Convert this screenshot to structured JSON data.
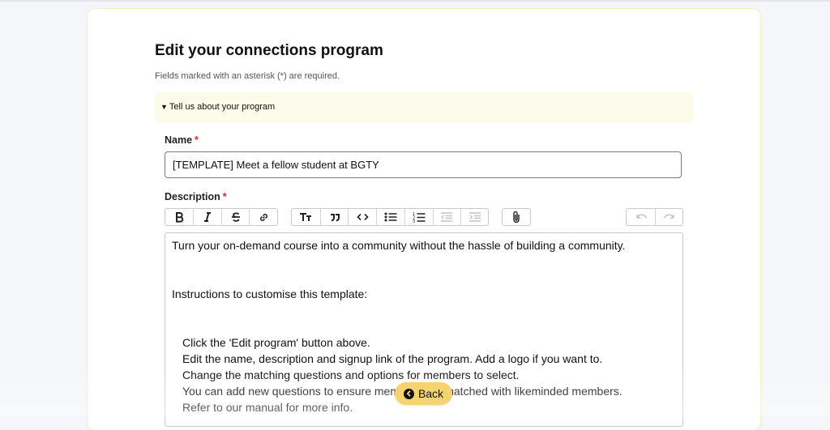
{
  "page": {
    "title": "Edit your connections program",
    "required_note": "Fields marked with an asterisk (*) are required."
  },
  "section": {
    "caret": "▼",
    "label": "Tell us about your program"
  },
  "form": {
    "name_label": "Name",
    "name_value": "[TEMPLATE] Meet a fellow student at BGTY",
    "description_label": "Description",
    "required_marker": "*"
  },
  "toolbar": {
    "groups": [
      [
        "bold",
        "italic",
        "strikethrough",
        "link"
      ],
      [
        "heading",
        "quote",
        "code",
        "bullet-list",
        "numbered-list",
        "decrease-indent",
        "increase-indent"
      ],
      [
        "attach-file"
      ],
      [
        "undo",
        "redo"
      ]
    ],
    "disabled": [
      "decrease-indent",
      "increase-indent",
      "undo",
      "redo"
    ]
  },
  "editor": {
    "lines": [
      "Turn your on-demand course into a community without the hassle of building a community.",
      "Instructions to customise this template:",
      "Click the 'Edit program' button above.",
      "Edit the name, description and signup link of the program. Add a logo if you want to.",
      "Change the matching questions and options for members to select.",
      "You can add new questions to ensure members are matched with likeminded members.",
      "Refer to our manual for more info."
    ]
  },
  "back_button": {
    "label": "Back",
    "icon": "chevron-left-circle-icon"
  },
  "colors": {
    "section_bg": "#fdfbe9",
    "back_button": "#f5d36e",
    "required": "#d42e2e"
  }
}
